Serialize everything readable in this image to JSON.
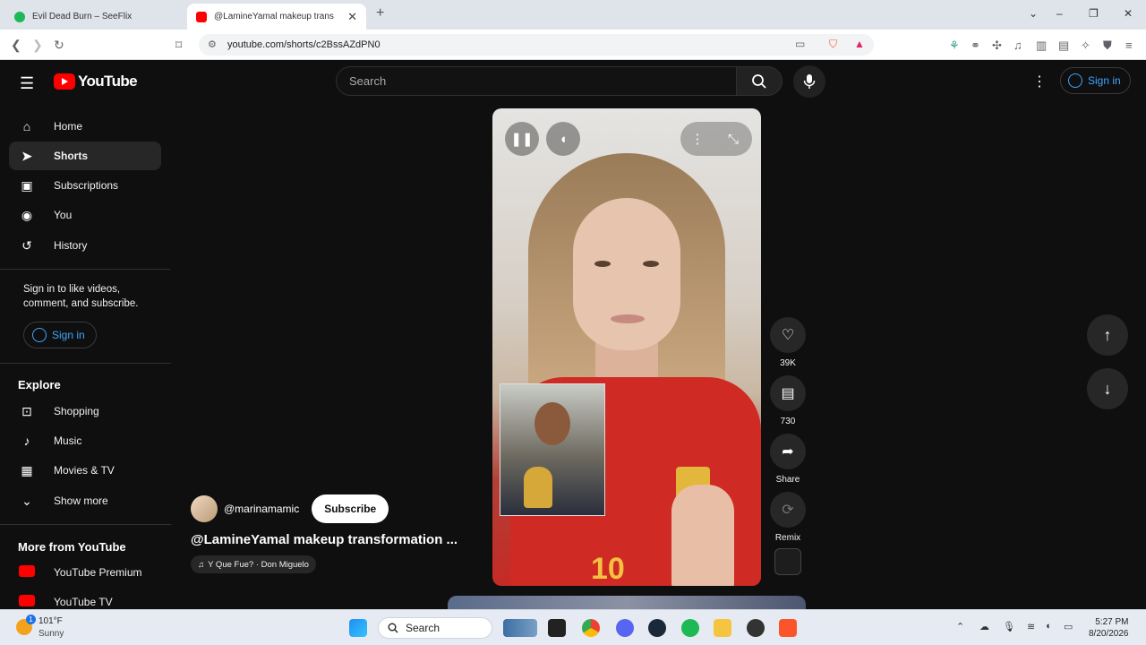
{
  "browser": {
    "tabs": [
      {
        "title": "Evil Dead Burn – SeeFlix",
        "active": false,
        "favicon_color": "#1db954"
      },
      {
        "title": "@LamineYamal makeup trans",
        "active": true,
        "favicon_color": "#ff0000"
      }
    ],
    "new_tab": "+",
    "window_controls": {
      "chevron": "⌄",
      "minimize": "–",
      "maximize": "❐",
      "close": "✕"
    },
    "url": "youtube.com/shorts/c2BssAZdPN0"
  },
  "yt": {
    "logo_text": "YouTube",
    "search_placeholder": "Search",
    "sign_in": "Sign in",
    "sidebar": {
      "main": [
        {
          "label": "Home",
          "icon": "home-icon",
          "glyph": "⌂"
        },
        {
          "label": "Shorts",
          "icon": "shorts-icon",
          "glyph": "➤",
          "selected": true
        },
        {
          "label": "Subscriptions",
          "icon": "subscriptions-icon",
          "glyph": "▣"
        },
        {
          "label": "You",
          "icon": "you-icon",
          "glyph": "◉"
        },
        {
          "label": "History",
          "icon": "history-icon",
          "glyph": "↺"
        }
      ],
      "sign_prompt": "Sign in to like videos, comment, and subscribe.",
      "sign_in": "Sign in",
      "explore_heading": "Explore",
      "explore": [
        {
          "label": "Shopping",
          "icon": "shopping-icon",
          "glyph": "🛍"
        },
        {
          "label": "Music",
          "icon": "music-icon",
          "glyph": "♪"
        },
        {
          "label": "Movies & TV",
          "icon": "movies-icon",
          "glyph": "🎬"
        },
        {
          "label": "Show more",
          "icon": "chevron-down-icon",
          "glyph": "⌄"
        }
      ],
      "more_heading": "More from YouTube",
      "more": [
        {
          "label": "YouTube Premium"
        },
        {
          "label": "YouTube TV"
        }
      ]
    },
    "short": {
      "channel": "@marinamamic",
      "subscribe": "Subscribe",
      "title": "@LamineYamal makeup transformation ...",
      "music": "Y Que Fue? · Don Miguelo",
      "jersey_number": "10",
      "likes": "39K",
      "comments": "730",
      "share": "Share",
      "remix": "Remix"
    }
  },
  "taskbar": {
    "temp": "101°F",
    "condition": "Sunny",
    "search": "Search",
    "time": "5:27 PM",
    "date": "8/20/2026",
    "weather_badge": "1"
  }
}
